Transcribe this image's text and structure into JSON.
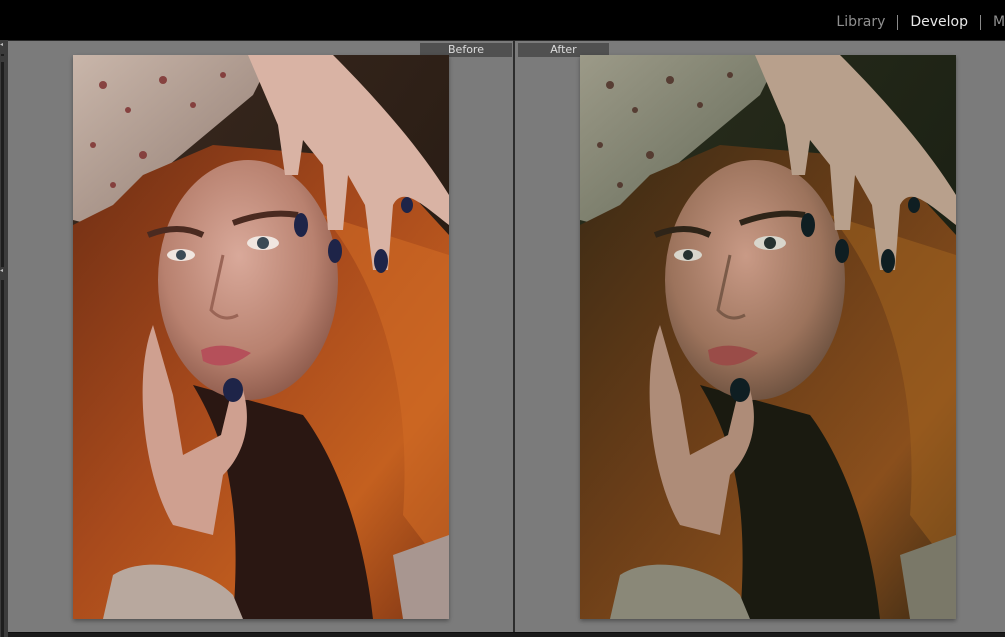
{
  "module_picker": {
    "items": [
      {
        "label": "Library",
        "active": false
      },
      {
        "label": "Develop",
        "active": true
      },
      {
        "label": "M",
        "active": false
      }
    ]
  },
  "compare_view": {
    "before_label": "Before",
    "after_label": "After"
  },
  "colors": {
    "workspace_bg": "#7b7b7b",
    "label_bg": "#505050",
    "active_module": "#e8e8e8",
    "inactive_module": "#8f8f8f"
  }
}
